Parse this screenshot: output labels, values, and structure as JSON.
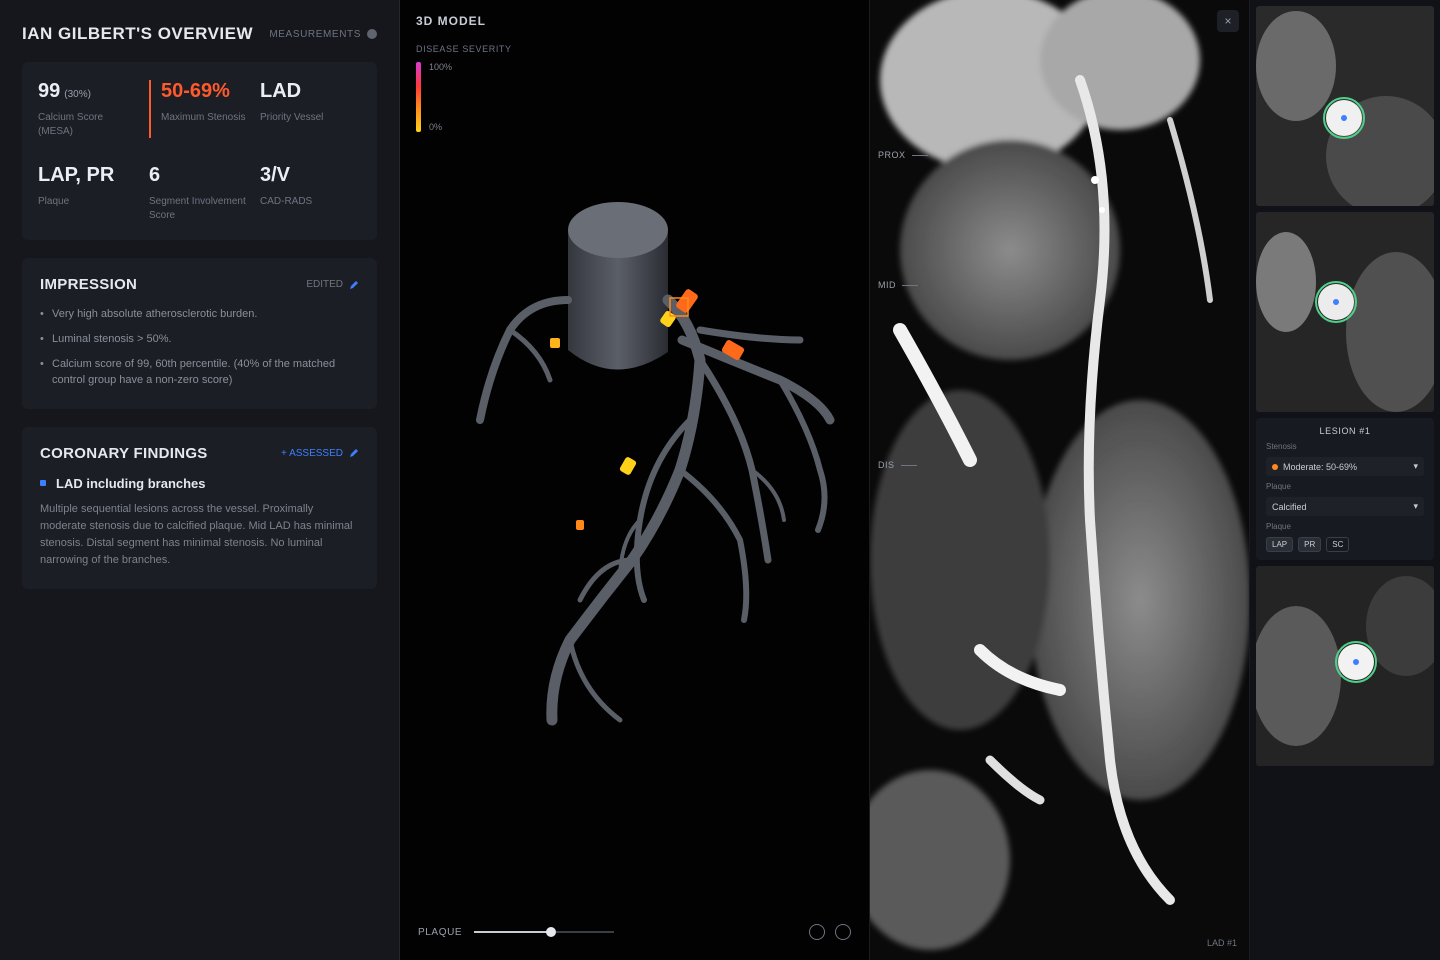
{
  "overview": {
    "title": "IAN GILBERT'S OVERVIEW",
    "measurements_label": "MEASUREMENTS",
    "stats": [
      {
        "value": "99",
        "unit": "(30%)",
        "label": "Calcium Score (MESA)",
        "highlight": false
      },
      {
        "value": "50-69%",
        "unit": "",
        "label": "Maximum Stenosis",
        "highlight": true
      },
      {
        "value": "LAD",
        "unit": "",
        "label": "Priority Vessel",
        "highlight": false
      },
      {
        "value": "LAP, PR",
        "unit": "",
        "label": "Plaque",
        "highlight": false
      },
      {
        "value": "6",
        "unit": "",
        "label": "Segment Involvement Score",
        "highlight": false
      },
      {
        "value": "3/V",
        "unit": "",
        "label": "CAD-RADS",
        "highlight": false
      }
    ]
  },
  "impression": {
    "title": "IMPRESSION",
    "action": "EDITED",
    "bullets": [
      "Very high absolute atherosclerotic burden.",
      "Luminal stenosis > 50%.",
      "Calcium score of 99, 60th percentile. (40% of the matched control group have a non-zero score)"
    ]
  },
  "coronary_findings": {
    "title": "CORONARY FINDINGS",
    "action": "+ ASSESSED",
    "finding_name": "LAD including branches",
    "finding_text": "Multiple sequential lesions across the vessel. Proximally moderate stenosis due to calcified plaque. Mid LAD has minimal stenosis. Distal segment has minimal stenosis. No luminal narrowing of the branches."
  },
  "viewport3d": {
    "title": "3D MODEL",
    "severity_label": "DISEASE SEVERITY",
    "severity_max": "100%",
    "severity_min": "0%",
    "plaque_label": "PLAQUE",
    "plaque_slider_value": 0.55
  },
  "ct_view": {
    "segment_labels": [
      "PROX",
      "MID",
      "DIS"
    ],
    "caption": "LAD #1"
  },
  "cross_section": {
    "lesion_title": "LESION #1",
    "stenosis_label": "Stenosis",
    "stenosis_value": "Moderate: 50-69%",
    "plaque_label": "Plaque",
    "plaque_value": "Calcified",
    "features_label": "Plaque",
    "chips": [
      "LAP",
      "PR",
      "SC"
    ]
  },
  "colors": {
    "accent_blue": "#3d7fff",
    "warning_orange": "#ff5a2c",
    "lesion_yellow": "#ffd21a"
  }
}
